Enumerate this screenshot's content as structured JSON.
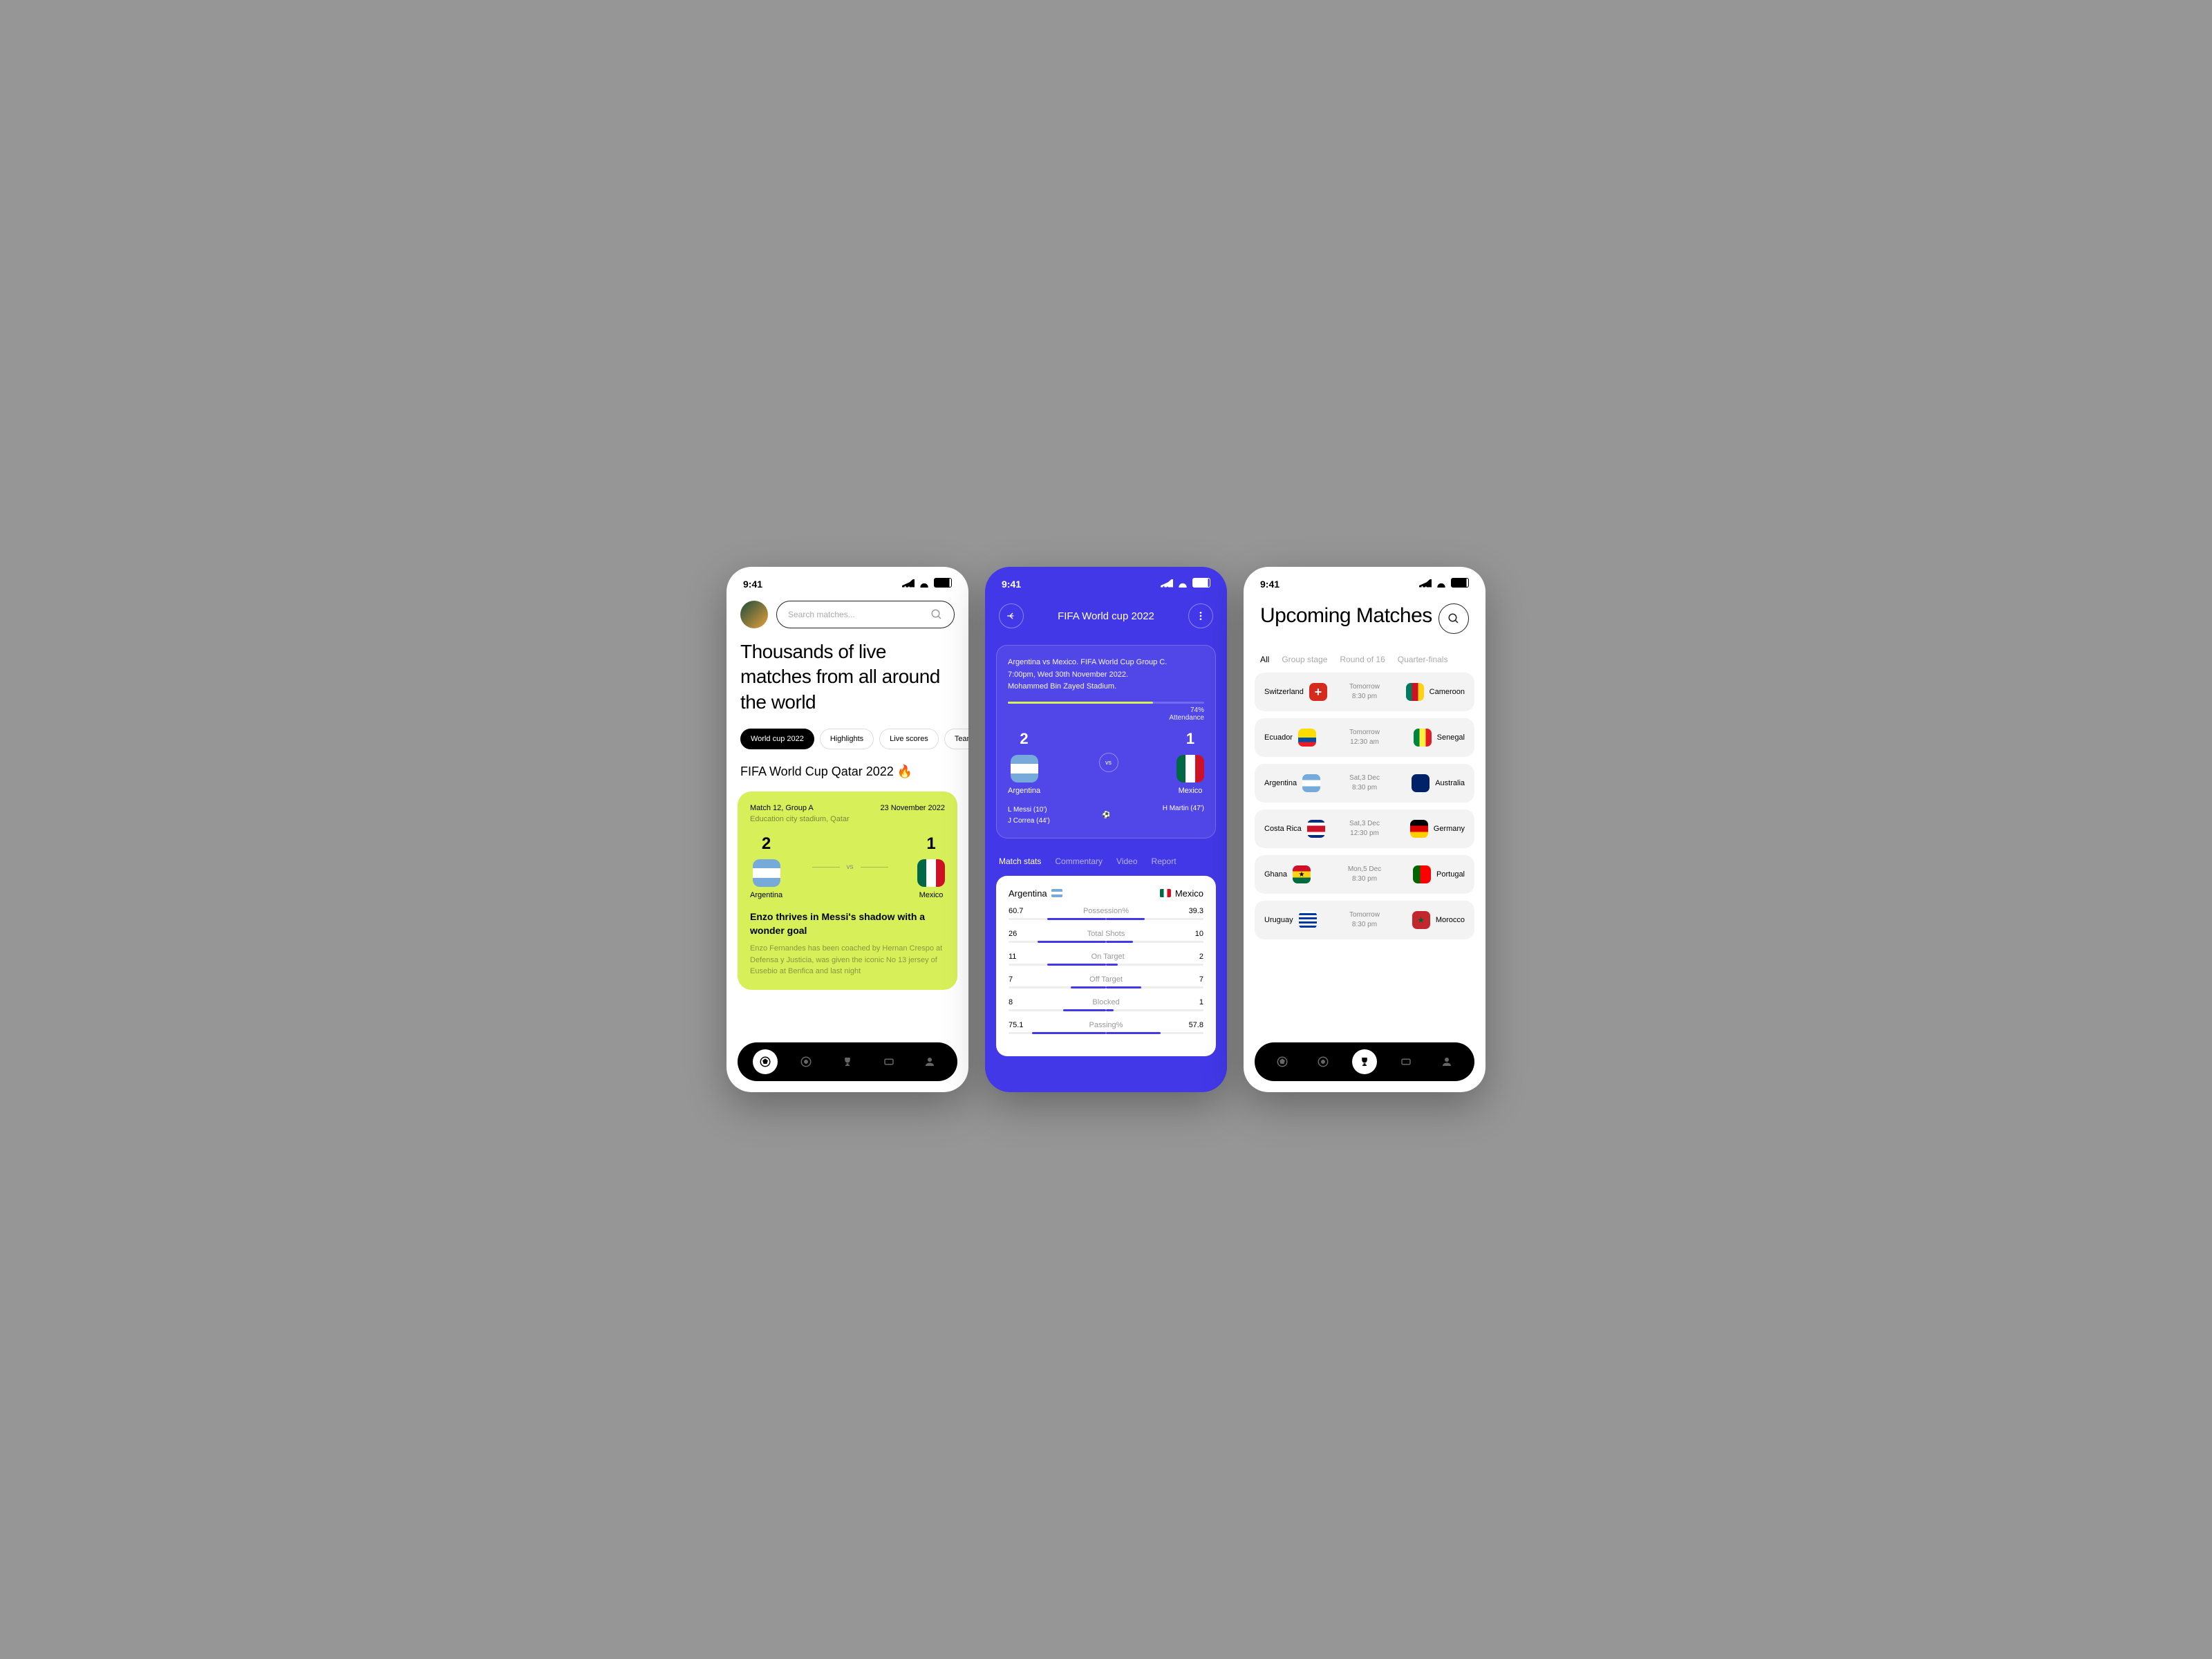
{
  "status_time": "9:41",
  "phone1": {
    "search_placeholder": "Search matches...",
    "hero": "Thousands of live matches from all around the world",
    "chips": [
      "World cup 2022",
      "Highlights",
      "Live scores",
      "Teams"
    ],
    "section_title": "FIFA World Cup Qatar 2022 🔥",
    "card": {
      "match_label": "Match 12, Group A",
      "date": "23 November 2022",
      "venue": "Education city stadium, Qatar",
      "team1": "Argentina",
      "team2": "Mexico",
      "score1": "2",
      "score2": "1",
      "vs": "vs",
      "headline": "Enzo thrives in Messi's shadow with a wonder goal",
      "body": "Enzo Fernandes has been coached by Hernan Crespo at Defensa y Justicia, was given the iconic No 13 jersey of Eusebio at Benfica and last night"
    }
  },
  "phone2": {
    "title": "FIFA World cup 2022",
    "info_line1": "Argentina vs Mexico. FIFA World Cup Group C.",
    "info_line2": "7:00pm, Wed 30th November 2022.",
    "info_line3": "Mohammed Bin Zayed Stadium.",
    "attendance_pct": "74%",
    "attendance_label": "Attendance",
    "score1": "2",
    "score2": "1",
    "team1": "Argentina",
    "team2": "Mexico",
    "vs": "vs",
    "scorer1a": "L Messi (10')",
    "scorer1b": "J Correa (44')",
    "scorer2a": "H Martin (47')",
    "tabs": [
      "Match stats",
      "Commentary",
      "Video",
      "Report"
    ],
    "stats": {
      "team1": "Argentina",
      "team2": "Mexico",
      "rows": [
        {
          "label": "Possession%",
          "left": "60.7",
          "right": "39.3",
          "lw": 30,
          "rw": 20
        },
        {
          "label": "Total Shots",
          "left": "26",
          "right": "10",
          "lw": 35,
          "rw": 14
        },
        {
          "label": "On Target",
          "left": "11",
          "right": "2",
          "lw": 30,
          "rw": 6
        },
        {
          "label": "Off Target",
          "left": "7",
          "right": "7",
          "lw": 18,
          "rw": 18
        },
        {
          "label": "Blocked",
          "left": "8",
          "right": "1",
          "lw": 22,
          "rw": 4
        },
        {
          "label": "Passing%",
          "left": "75.1",
          "right": "57.8",
          "lw": 38,
          "rw": 28
        }
      ]
    }
  },
  "phone3": {
    "title": "Upcoming Matches",
    "tabs": [
      "All",
      "Group stage",
      "Round of 16",
      "Quarter-finals"
    ],
    "matches": [
      {
        "t1": "Switzerland",
        "f1": "ch",
        "day": "Tomorrow",
        "time": "8:30 pm",
        "t2": "Cameroon",
        "f2": "cm"
      },
      {
        "t1": "Ecuador",
        "f1": "ec",
        "day": "Tomorrow",
        "time": "12:30 am",
        "t2": "Senegal",
        "f2": "sn"
      },
      {
        "t1": "Argentina",
        "f1": "ar",
        "day": "Sat,3 Dec",
        "time": "8:30 pm",
        "t2": "Australia",
        "f2": "au"
      },
      {
        "t1": "Costa Rica",
        "f1": "cr",
        "day": "Sat,3 Dec",
        "time": "12:30 pm",
        "t2": "Germany",
        "f2": "de"
      },
      {
        "t1": "Ghana",
        "f1": "gh",
        "day": "Mon,5 Dec",
        "time": "8:30 pm",
        "t2": "Portugal",
        "f2": "pt"
      },
      {
        "t1": "Uruguay",
        "f1": "uy",
        "day": "Tomorrow",
        "time": "8:30 pm",
        "t2": "Morocco",
        "f2": "ma"
      }
    ]
  }
}
